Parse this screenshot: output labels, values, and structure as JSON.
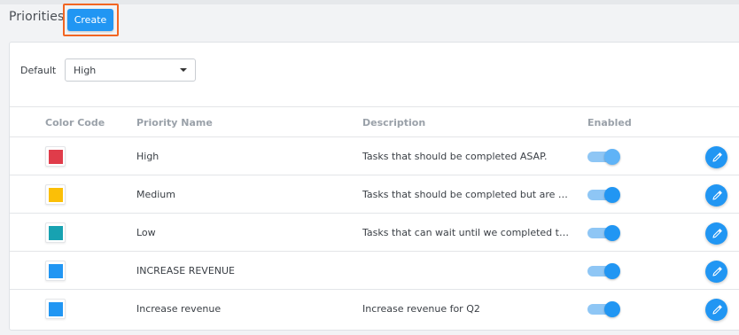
{
  "header": {
    "title": "Priorities",
    "create_label": "Create"
  },
  "colors": {
    "accent": "#2196f3",
    "highlight": "#f26522"
  },
  "default_field": {
    "label": "Default",
    "value": "High"
  },
  "table": {
    "columns": [
      "Color Code",
      "Priority Name",
      "Description",
      "Enabled"
    ],
    "rows": [
      {
        "color": "#e03c4a",
        "name": "High",
        "description": "Tasks that should be completed ASAP.",
        "enabled": true
      },
      {
        "color": "#fbbf07",
        "name": "Medium",
        "description": "Tasks that should be completed but are not ur...",
        "enabled": true
      },
      {
        "color": "#17a2b1",
        "name": "Low",
        "description": "Tasks that can wait until we completed the Hi...",
        "enabled": true
      },
      {
        "color": "#2196f3",
        "name": "INCREASE REVENUE",
        "description": "",
        "enabled": true
      },
      {
        "color": "#2196f3",
        "name": "Increase revenue",
        "description": "Increase revenue for Q2",
        "enabled": true
      }
    ]
  },
  "icons": {
    "edit": "pencil-icon",
    "dropdown": "caret-down-icon"
  }
}
